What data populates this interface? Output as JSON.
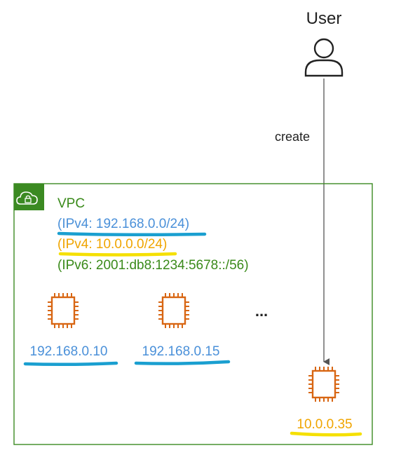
{
  "user": {
    "label": "User",
    "icon": "user-icon"
  },
  "arrow": {
    "label": "create"
  },
  "vpc": {
    "title": "VPC",
    "icon": "vpc-cloud-lock-icon",
    "cidrs": [
      {
        "text": "(IPv4: 192.168.0.0/24)",
        "color": "#4a90d9",
        "underline": "#1a9fd0"
      },
      {
        "text": "(IPv4: 10.0.0.0/24)",
        "color": "#f0a500",
        "underline": "#f5e000"
      },
      {
        "text": "(IPv6: 2001:db8:1234:5678::/56)",
        "color": "#3a8a1a",
        "underline": null
      }
    ],
    "ellipsis": "...",
    "instances": [
      {
        "ip": "192.168.0.10",
        "color": "#4a90d9",
        "underline": "#1a9fd0",
        "icon": "ec2-instance-icon"
      },
      {
        "ip": "192.168.0.15",
        "color": "#4a90d9",
        "underline": "#1a9fd0",
        "icon": "ec2-instance-icon"
      },
      {
        "ip": "10.0.0.35",
        "color": "#f0a500",
        "underline": "#f5e000",
        "icon": "ec2-instance-icon"
      }
    ]
  },
  "colors": {
    "vpc_border": "#3b8a22",
    "vpc_text": "#3a8a1a",
    "instance_icon": "#d86613",
    "arrow": "#555555",
    "text": "#222222"
  }
}
